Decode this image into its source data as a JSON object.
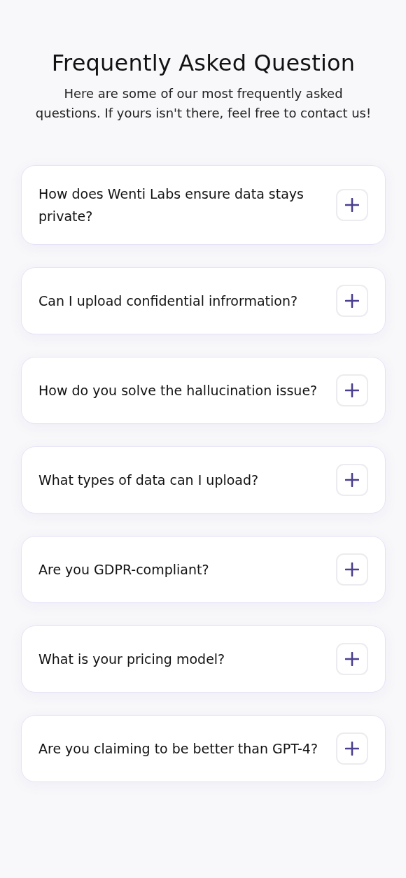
{
  "header": {
    "title": "Frequently Asked Question",
    "subtitle": "Here are some of our most frequently asked questions. If yours isn't there, feel free to contact us!"
  },
  "faqs": [
    {
      "question": "How does Wenti Labs ensure data stays private?",
      "expanded": false
    },
    {
      "question": "Can I upload confidential infrormation?",
      "expanded": false
    },
    {
      "question": "How do you solve the hallucination issue?",
      "expanded": false
    },
    {
      "question": "What types of data can I upload?",
      "expanded": false
    },
    {
      "question": "Are you GDPR-compliant?",
      "expanded": false
    },
    {
      "question": "What is your pricing model?",
      "expanded": false
    },
    {
      "question": "Are you claiming to be better than GPT-4?",
      "expanded": false
    }
  ]
}
